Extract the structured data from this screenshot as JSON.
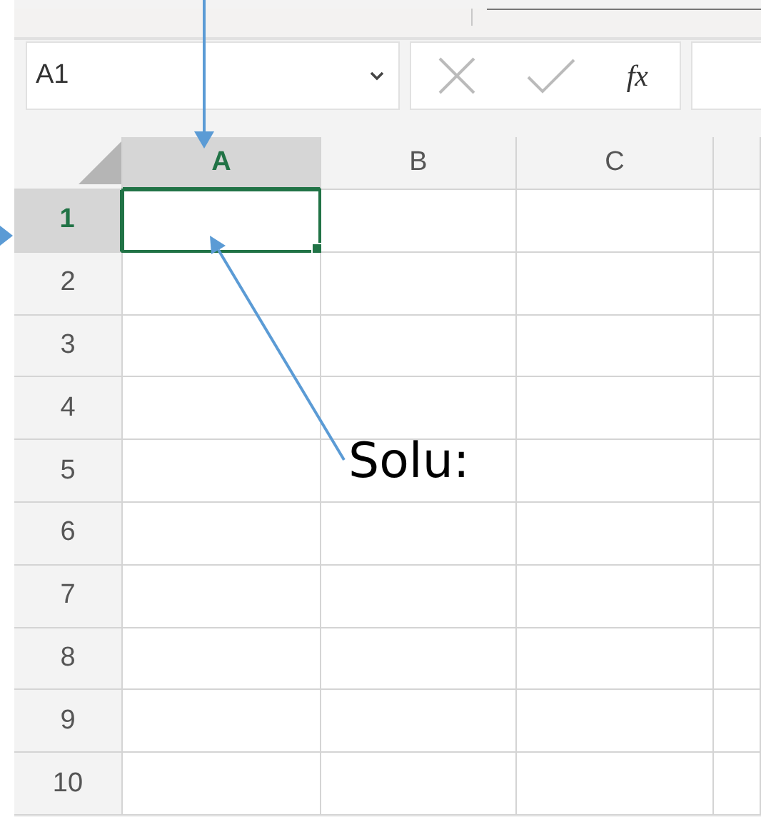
{
  "name_box": {
    "value": "A1"
  },
  "formula_bar": {
    "function_label": "fx"
  },
  "columns": [
    {
      "label": "A",
      "selected": true
    },
    {
      "label": "B",
      "selected": false
    },
    {
      "label": "C",
      "selected": false
    }
  ],
  "rows": [
    {
      "label": "1",
      "selected": true
    },
    {
      "label": "2",
      "selected": false
    },
    {
      "label": "3",
      "selected": false
    },
    {
      "label": "4",
      "selected": false
    },
    {
      "label": "5",
      "selected": false
    },
    {
      "label": "6",
      "selected": false
    },
    {
      "label": "7",
      "selected": false
    },
    {
      "label": "8",
      "selected": false
    },
    {
      "label": "9",
      "selected": false
    },
    {
      "label": "10",
      "selected": false
    }
  ],
  "annotation": {
    "text": "Solu:"
  }
}
